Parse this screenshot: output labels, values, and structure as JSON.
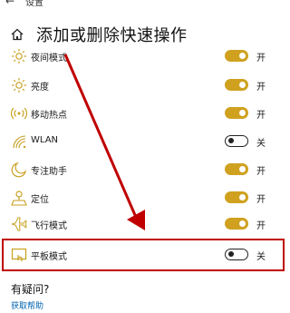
{
  "topbar": {
    "back_glyph": "←",
    "title": "设置"
  },
  "header": {
    "title": "添加或删除快速操作"
  },
  "items": [
    {
      "label": "夜间模式",
      "state": "开",
      "on": true,
      "icon": "night-light-icon"
    },
    {
      "label": "亮度",
      "state": "开",
      "on": true,
      "icon": "brightness-icon"
    },
    {
      "label": "移动热点",
      "state": "开",
      "on": true,
      "icon": "mobile-hotspot-icon"
    },
    {
      "label": "WLAN",
      "state": "关",
      "on": false,
      "icon": "wifi-icon"
    },
    {
      "label": "专注助手",
      "state": "开",
      "on": true,
      "icon": "focus-assist-icon"
    },
    {
      "label": "定位",
      "state": "开",
      "on": true,
      "icon": "location-icon"
    },
    {
      "label": "飞行模式",
      "state": "开",
      "on": true,
      "icon": "airplane-icon"
    },
    {
      "label": "平板模式",
      "state": "关",
      "on": false,
      "icon": "tablet-mode-icon"
    }
  ],
  "help": {
    "question": "有疑问?",
    "link": "获取帮助"
  },
  "colors": {
    "toggle_on": "#cfa11f",
    "annotation_red": "#c00000",
    "link": "#0063b1"
  }
}
